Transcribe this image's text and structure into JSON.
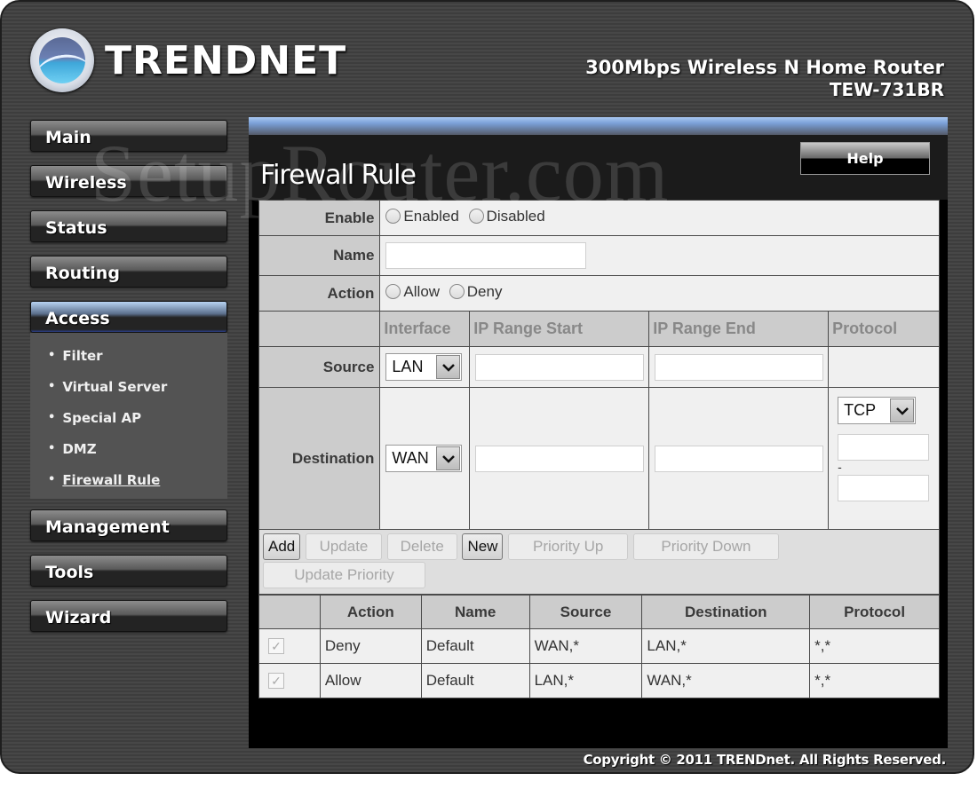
{
  "brand": {
    "logo_text": "TRENDnet",
    "product_line": "300Mbps Wireless N Home Router",
    "model": "TEW-731BR"
  },
  "watermark": "SetupRouter.com",
  "sidebar": {
    "items": [
      {
        "label": "Main"
      },
      {
        "label": "Wireless"
      },
      {
        "label": "Status"
      },
      {
        "label": "Routing"
      },
      {
        "label": "Access",
        "active": true
      },
      {
        "label": "Management"
      },
      {
        "label": "Tools"
      },
      {
        "label": "Wizard"
      }
    ],
    "access_submenu": [
      {
        "label": "Filter"
      },
      {
        "label": "Virtual Server"
      },
      {
        "label": "Special AP"
      },
      {
        "label": "DMZ"
      },
      {
        "label": "Firewall Rule",
        "current": true
      }
    ]
  },
  "page": {
    "title": "Firewall Rule",
    "help_label": "Help"
  },
  "form": {
    "enable": {
      "label": "Enable",
      "options": [
        "Enabled",
        "Disabled"
      ],
      "selected": null
    },
    "name": {
      "label": "Name",
      "value": ""
    },
    "action": {
      "label": "Action",
      "options": [
        "Allow",
        "Deny"
      ],
      "selected": null
    },
    "columns": [
      "Interface",
      "IP Range Start",
      "IP Range End",
      "Protocol"
    ],
    "source": {
      "label": "Source",
      "interface": "LAN",
      "ip_start": "",
      "ip_end": ""
    },
    "destination": {
      "label": "Destination",
      "interface": "WAN",
      "ip_start": "",
      "ip_end": "",
      "protocol": "TCP",
      "port_start": "",
      "port_separator": "-",
      "port_end": ""
    }
  },
  "buttons": {
    "add": "Add",
    "update": "Update",
    "delete": "Delete",
    "new": "New",
    "priority_up": "Priority Up",
    "priority_down": "Priority Down",
    "update_priority": "Update Priority"
  },
  "rules_table": {
    "headers": [
      "",
      "Action",
      "Name",
      "Source",
      "Destination",
      "Protocol"
    ],
    "rows": [
      {
        "checked": true,
        "action": "Deny",
        "name": "Default",
        "source": "WAN,*",
        "destination": "LAN,*",
        "protocol": "*,*"
      },
      {
        "checked": true,
        "action": "Allow",
        "name": "Default",
        "source": "LAN,*",
        "destination": "WAN,*",
        "protocol": "*,*"
      }
    ]
  },
  "icons": {
    "dropdown": "chevron-down",
    "check": "✓",
    "bullet": "•"
  },
  "footer": {
    "copyright": "Copyright © 2011 TRENDnet. All Rights Reserved."
  }
}
